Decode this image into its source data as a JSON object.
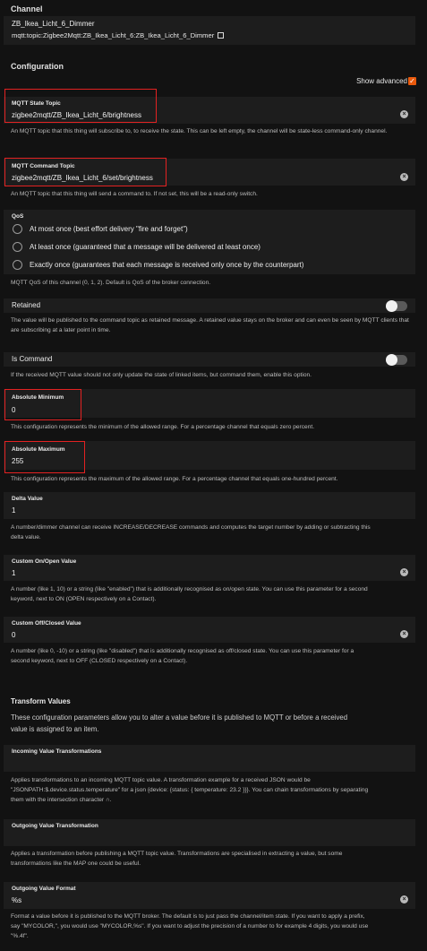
{
  "channel": {
    "section_title": "Channel",
    "name": "ZB_Ikea_Licht_6_Dimmer",
    "uid": "mqtt:topic:Zigbee2Mqtt:ZB_Ikea_Licht_6:ZB_Ikea_Licht_6_Dimmer",
    "copy_icon": "copy-icon"
  },
  "configuration": {
    "section_title": "Configuration",
    "show_advanced_label": "Show advanced",
    "show_advanced_checked": true,
    "accent_color": "#e8590c",
    "highlight_color": "#e32222"
  },
  "fields": {
    "state_topic": {
      "label": "MQTT State Topic",
      "value": "zigbee2mqtt/ZB_Ikea_Licht_6/brightness",
      "description": "An MQTT topic that this thing will subscribe to, to receive the state. This can be left empty, the channel will be state-less command-only channel."
    },
    "command_topic": {
      "label": "MQTT Command Topic",
      "value": "zigbee2mqtt/ZB_Ikea_Licht_6/set/brightness",
      "description": "An MQTT topic that this thing will send a command to. If not set, this will be a read-only switch."
    },
    "qos": {
      "label": "QoS",
      "options": [
        "At most once (best effort delivery \"fire and forget\")",
        "At least once (guaranteed that a message will be delivered at least once)",
        "Exactly once (guarantees that each message is received only once by the counterpart)"
      ],
      "description": "MQTT QoS of this channel (0, 1, 2). Default is QoS of the broker connection."
    },
    "retained": {
      "label": "Retained",
      "on": false,
      "description": "The value will be published to the command topic as retained message. A retained value stays on the broker and can even be seen by MQTT clients that are subscribing at a later point in time."
    },
    "is_command": {
      "label": "Is Command",
      "on": false,
      "description": "If the received MQTT value should not only update the state of linked items, but command them, enable this option."
    },
    "abs_min": {
      "label": "Absolute Minimum",
      "value": "0",
      "description": "This configuration represents the minimum of the allowed range. For a percentage channel that equals zero percent."
    },
    "abs_max": {
      "label": "Absolute Maximum",
      "value": "255",
      "description": "This configuration represents the maximum of the allowed range. For a percentage channel that equals one-hundred percent."
    },
    "delta": {
      "label": "Delta Value",
      "value": "1",
      "description_l1": "A number/dimmer channel can receive INCREASE/DECREASE commands and computes the target number by adding or subtracting this",
      "description_l2": "delta value."
    },
    "custom_on": {
      "label": "Custom On/Open Value",
      "value": "1",
      "description_l1": "A number (like 1, 10) or a string (like \"enabled\") that is additionally recognised as on/open state. You can use this parameter for a second",
      "description_l2": "keyword, next to ON (OPEN respectively on a Contact)."
    },
    "custom_off": {
      "label": "Custom Off/Closed Value",
      "value": "0",
      "description_l1": "A number (like 0, -10) or a string (like \"disabled\") that is additionally recognised as off/closed state. You can use this parameter for a",
      "description_l2": "second keyword, next to OFF (CLOSED respectively on a Contact)."
    }
  },
  "transform": {
    "section_title": "Transform Values",
    "intro_l1": "These configuration parameters allow you to alter a value before it is published to MQTT or before a received",
    "intro_l2": "value is assigned to an item.",
    "incoming": {
      "label": "Incoming Value Transformations",
      "value": "",
      "description_l1": "Applies transformations to an incoming MQTT topic value. A transformation example for a received JSON would be",
      "description_l2": "\"JSONPATH:$.device.status.temperature\" for a json {device: {status: { temperature: 23.2 }}}. You can chain transformations by separating",
      "description_l3": "them with the intersection character ∩."
    },
    "outgoing": {
      "label": "Outgoing Value Transformation",
      "value": "",
      "description_l1": "Applies a transformation before publishing a MQTT topic value. Transformations are specialised in extracting a value, but some",
      "description_l2": "transformations like the MAP one could be useful."
    },
    "format": {
      "label": "Outgoing Value Format",
      "value": "%s",
      "description_l1": "Format a value before it is published to the MQTT broker. The default is to just pass the channel/item state. If you want to apply a prefix,",
      "description_l2": "say \"MYCOLOR,\", you would use \"MYCOLOR,%s\". If you want to adjust the precision of a number to for example 4 digits, you would use",
      "description_l3": "\"%.4f\"."
    }
  }
}
